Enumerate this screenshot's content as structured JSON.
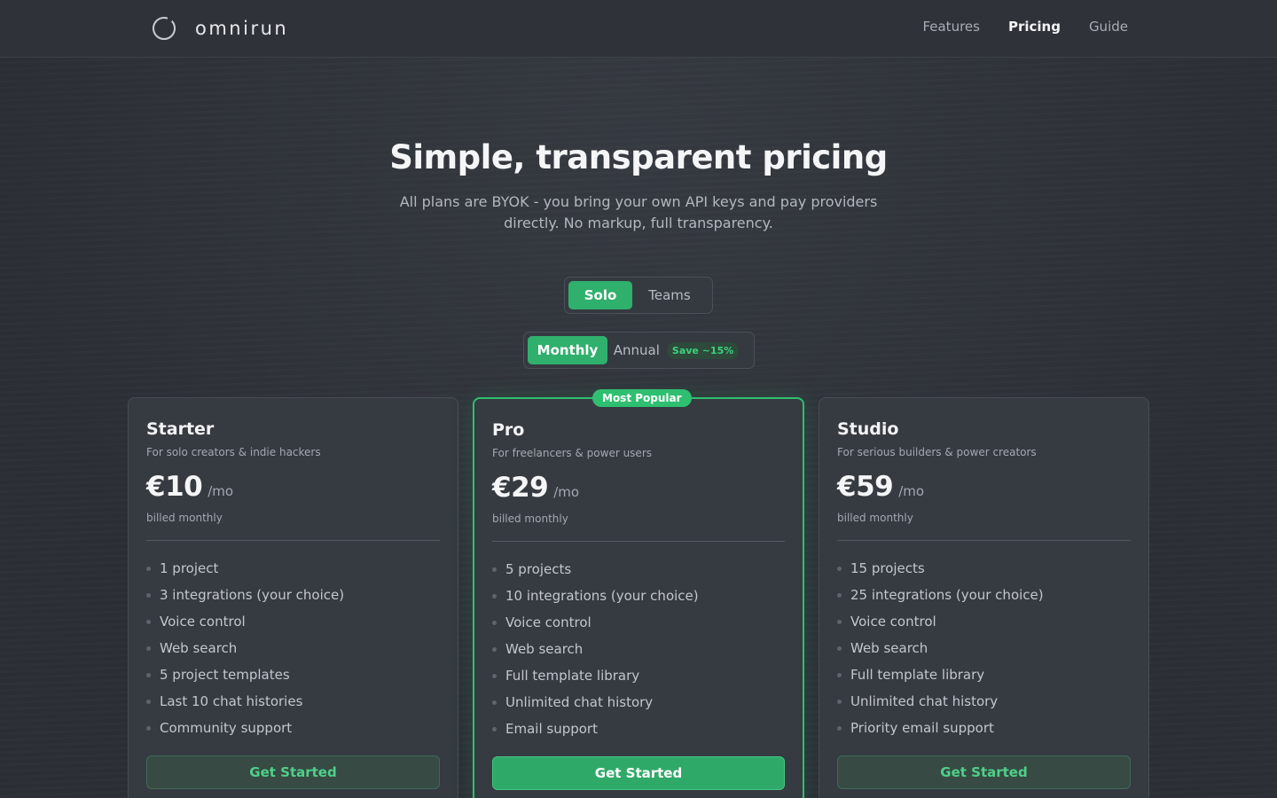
{
  "brand": {
    "name": "omnirun"
  },
  "nav": {
    "features": "Features",
    "pricing": "Pricing",
    "guide": "Guide"
  },
  "hero": {
    "title": "Simple, transparent pricing",
    "subtitle_line1": "All plans are BYOK - you bring your own API keys and pay providers",
    "subtitle_line2": "directly. No markup, full transparency."
  },
  "audience_toggle": {
    "solo": "Solo",
    "teams": "Teams",
    "selected": "Solo"
  },
  "billing_toggle": {
    "monthly": "Monthly",
    "annual": "Annual",
    "save_badge": "Save ~15%",
    "selected": "Monthly"
  },
  "plans": [
    {
      "name": "Starter",
      "description": "For solo creators & indie hackers",
      "price": "€10",
      "per": "/mo",
      "billed": "billed monthly",
      "features": [
        "1 project",
        "3 integrations (your choice)",
        "Voice control",
        "Web search",
        "5 project templates",
        "Last 10 chat histories",
        "Community support"
      ],
      "cta": "Get Started"
    },
    {
      "name": "Pro",
      "badge": "Most Popular",
      "description": "For freelancers & power users",
      "price": "€29",
      "per": "/mo",
      "billed": "billed monthly",
      "features": [
        "5 projects",
        "10 integrations (your choice)",
        "Voice control",
        "Web search",
        "Full template library",
        "Unlimited chat history",
        "Email support"
      ],
      "cta": "Get Started"
    },
    {
      "name": "Studio",
      "description": "For serious builders & power creators",
      "price": "€59",
      "per": "/mo",
      "billed": "billed monthly",
      "features": [
        "15 projects",
        "25 integrations (your choice)",
        "Voice control",
        "Web search",
        "Full template library",
        "Unlimited chat history",
        "Priority email support"
      ],
      "cta": "Get Started"
    }
  ],
  "colors": {
    "accent": "#2fbf70",
    "background": "#2e3238",
    "card": "#363a41"
  }
}
